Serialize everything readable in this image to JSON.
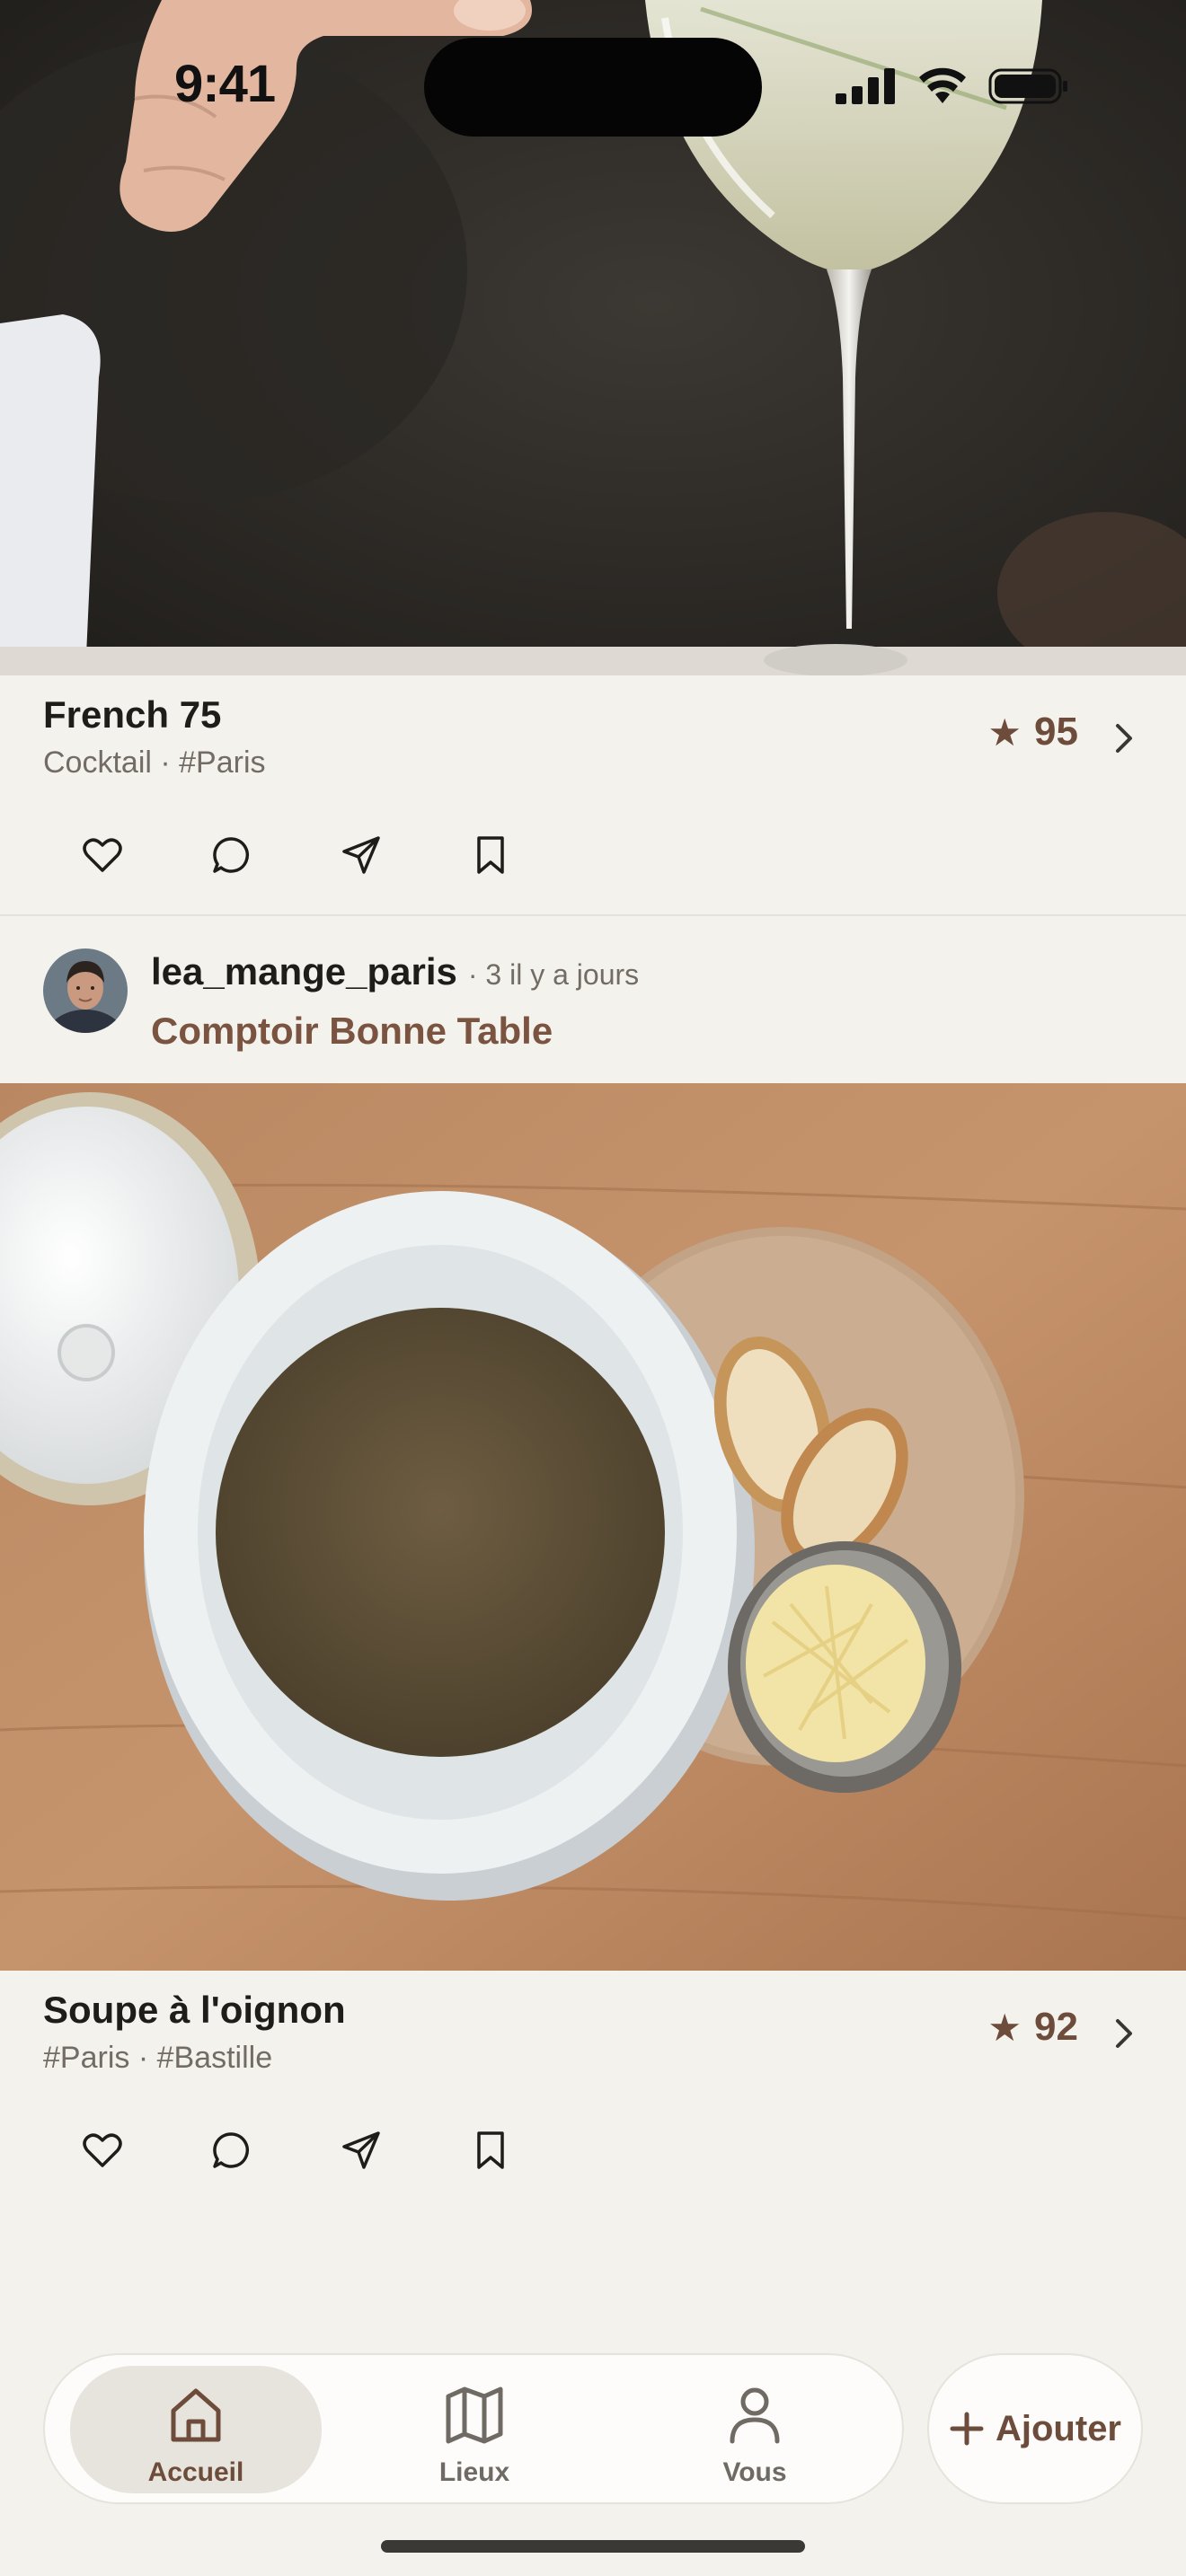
{
  "status_bar": {
    "time": "9:41"
  },
  "posts": [
    {
      "title": "French 75",
      "tags": "Cocktail · #Paris",
      "score": "95",
      "image": "cocktail-photo"
    },
    {
      "author": "lea_mange_paris",
      "time_ago": "· 3 il y a jours",
      "place": "Comptoir Bonne Table",
      "title": "Soupe à l'oignon",
      "tags": "#Paris · #Bastille",
      "score": "92",
      "image": "onion-soup-photo"
    }
  ],
  "actions": [
    "heart-icon",
    "comment-icon",
    "send-icon",
    "bookmark-icon"
  ],
  "tab_bar": {
    "items": [
      {
        "label": "Accueil",
        "icon": "home-icon",
        "active": true
      },
      {
        "label": "Lieux",
        "icon": "map-icon",
        "active": false
      },
      {
        "label": "Vous",
        "icon": "person-icon",
        "active": false
      }
    ],
    "add_label": "Ajouter"
  },
  "colors": {
    "background": "#f4f2ed",
    "accent": "#6d4c3b",
    "place_link": "#7a5440",
    "muted_text": "#726c65"
  }
}
